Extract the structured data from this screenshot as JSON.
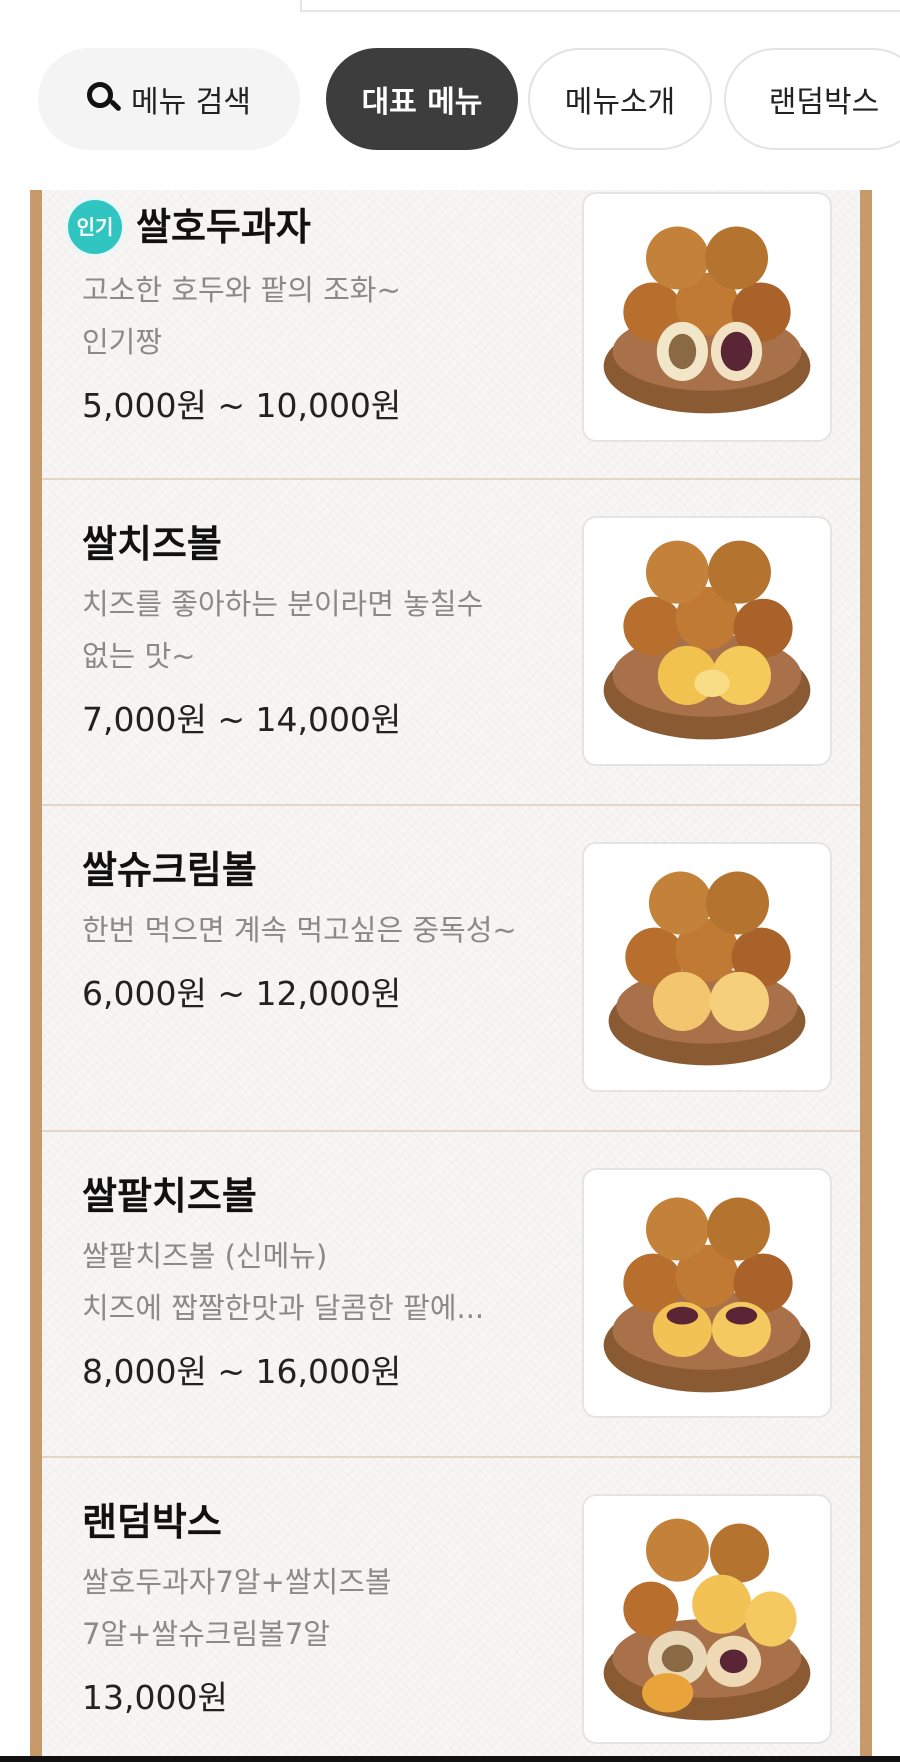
{
  "tabs": {
    "search_label": "메뉴 검색",
    "representative_label": "대표 메뉴",
    "intro_label": "메뉴소개",
    "random_label": "랜덤박스"
  },
  "menu": {
    "items": [
      {
        "badge": "인기",
        "name": "쌀호두과자",
        "desc_line1": "고소한 호두와 팥의 조화~",
        "desc_line2": "인기짱",
        "price": "5,000원 ~ 10,000원",
        "image_icon": "walnut-cake-red-bean-photo"
      },
      {
        "name": "쌀치즈볼",
        "desc_line1": "치즈를 좋아하는 분이라면 놓칠수",
        "desc_line2": "없는 맛~",
        "price": "7,000원 ~ 14,000원",
        "image_icon": "cheese-ball-photo"
      },
      {
        "name": "쌀슈크림볼",
        "desc_line1": "한번 먹으면 계속 먹고싶은 중독성~",
        "price": "6,000원 ~ 12,000원",
        "image_icon": "cream-ball-photo"
      },
      {
        "name": "쌀팥치즈볼",
        "desc_line1": "쌀팥치즈볼 (신메뉴)",
        "desc_line2": "치즈에 짭짤한맛과 달콤한 팥에...",
        "price": "8,000원 ~ 16,000원",
        "image_icon": "red-bean-cheese-ball-photo"
      },
      {
        "name": "랜덤박스",
        "desc_line1": "쌀호두과자7알+쌀치즈볼",
        "desc_line2": "7알+쌀슈크림볼7알",
        "price": "13,000원",
        "image_icon": "random-box-photo"
      }
    ]
  },
  "colors": {
    "accent_border": "#c79a6c",
    "active_tab": "#3d3d3d",
    "badge": "#31c5c2"
  }
}
